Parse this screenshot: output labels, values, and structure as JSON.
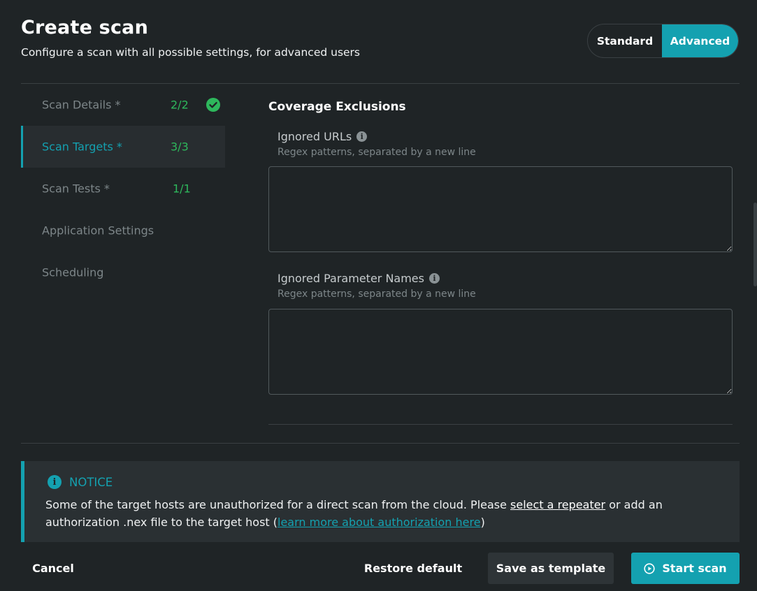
{
  "header": {
    "title": "Create scan",
    "subtitle": "Configure a scan with all possible settings, for advanced users"
  },
  "mode_toggle": {
    "options": [
      "Standard",
      "Advanced"
    ],
    "selected": "Advanced"
  },
  "nav": {
    "items": [
      {
        "label": "Scan Details *",
        "count": "2/2",
        "complete": true
      },
      {
        "label": "Scan Targets *",
        "count": "3/3",
        "active": true
      },
      {
        "label": "Scan Tests *",
        "count": "1/1"
      },
      {
        "label": "Application Settings"
      },
      {
        "label": "Scheduling"
      }
    ]
  },
  "section": {
    "title": "Coverage Exclusions",
    "ignored_urls": {
      "label": "Ignored URLs",
      "help": "Regex patterns, separated by a new line",
      "value": ""
    },
    "ignored_params": {
      "label": "Ignored Parameter Names",
      "help": "Regex patterns, separated by a new line",
      "value": ""
    }
  },
  "notice": {
    "title": "NOTICE",
    "text_1": "Some of the target hosts are unauthorized for a direct scan from the cloud. Please ",
    "link_1": "select a repeater",
    "text_2": " or add an authorization .nex file to the target host (",
    "link_2": "learn more about authorization here",
    "text_3": ")"
  },
  "footer": {
    "cancel": "Cancel",
    "restore": "Restore default",
    "save_template": "Save as template",
    "start": "Start scan"
  },
  "colors": {
    "accent": "#14a1b0",
    "success": "#2eb85c",
    "background": "#1f2426"
  }
}
